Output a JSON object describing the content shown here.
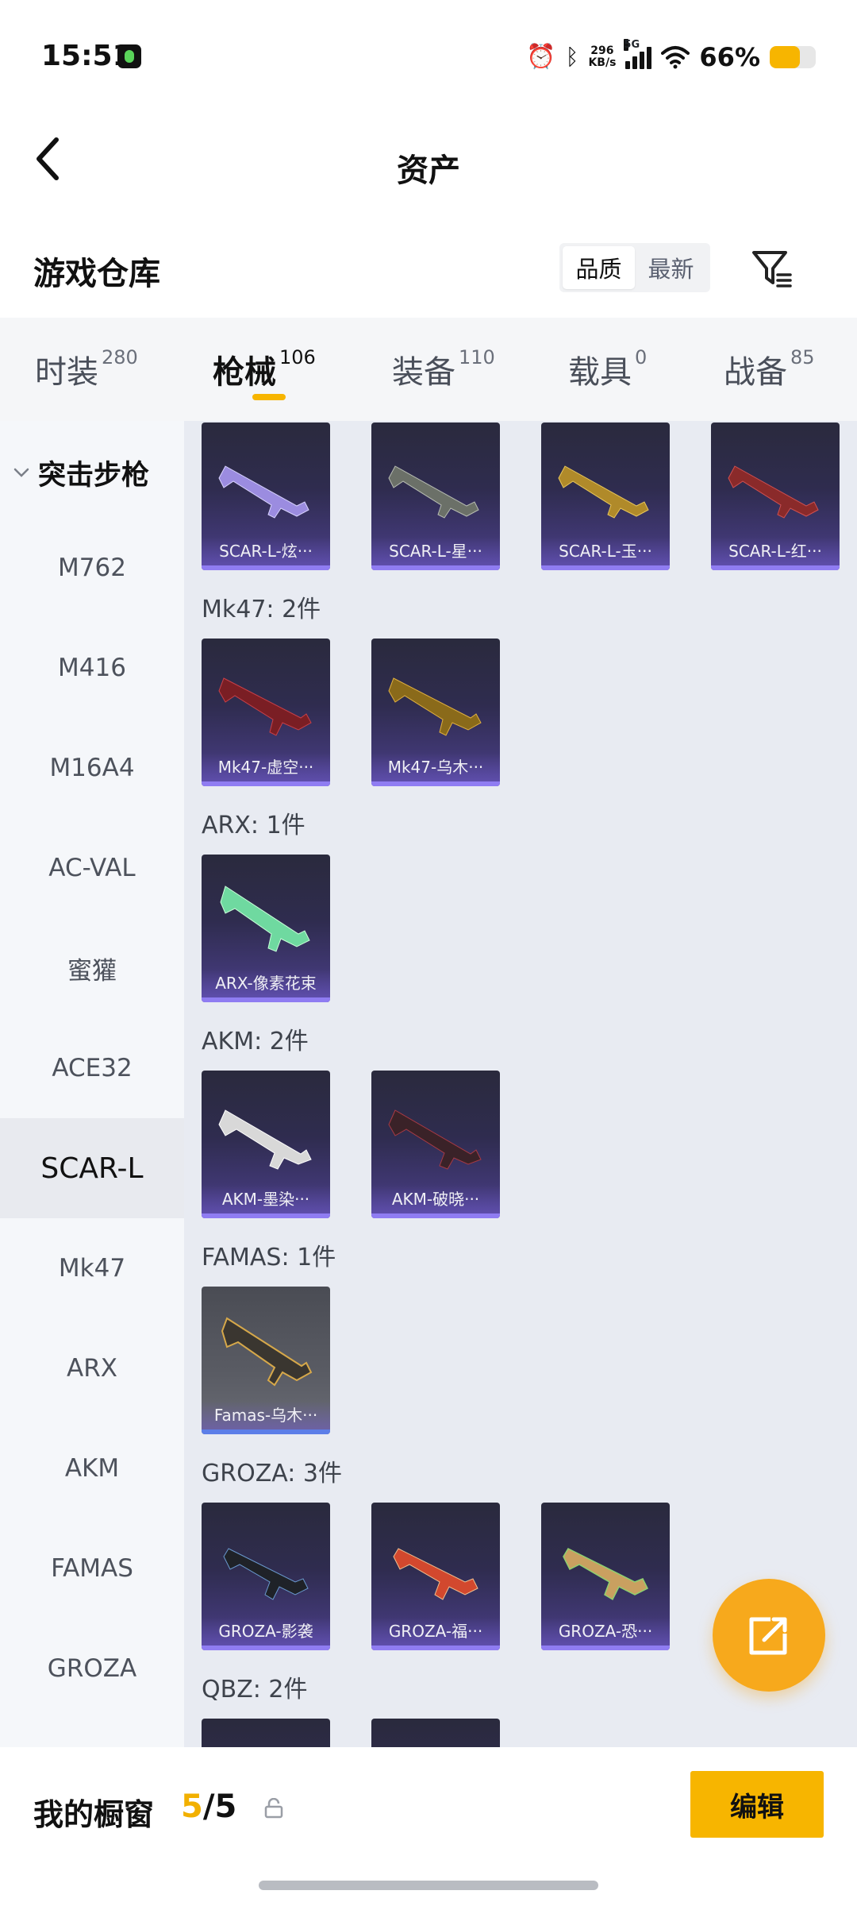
{
  "status": {
    "time": "15:51",
    "speed_top": "296",
    "speed_bottom": "KB/s",
    "network": "5G",
    "battery_pct": "66%",
    "battery_level": 0.66
  },
  "header": {
    "title": "资产"
  },
  "section": {
    "title": "游戏仓库",
    "sort_options": [
      "品质",
      "最新"
    ],
    "sort_active": "品质"
  },
  "tabs": [
    {
      "label": "时装",
      "count": "280"
    },
    {
      "label": "枪械",
      "count": "106",
      "active": true
    },
    {
      "label": "装备",
      "count": "110"
    },
    {
      "label": "载具",
      "count": "0"
    },
    {
      "label": "战备",
      "count": "85"
    }
  ],
  "sidebar": {
    "group": "突击步枪",
    "items": [
      "M762",
      "M416",
      "M16A4",
      "AC-VAL",
      "蜜獾",
      "ACE32",
      "SCAR-L",
      "Mk47",
      "ARX",
      "AKM",
      "FAMAS",
      "GROZA"
    ],
    "active": "SCAR-L"
  },
  "content": {
    "top_row": [
      "SCAR-L-炫···",
      "SCAR-L-星···",
      "SCAR-L-玉···",
      "SCAR-L-红···"
    ],
    "groups": [
      {
        "heading": "Mk47: 2件",
        "items": [
          "Mk47-虚空···",
          "Mk47-乌木···"
        ]
      },
      {
        "heading": "ARX: 1件",
        "items": [
          "ARX-像素花束"
        ]
      },
      {
        "heading": "AKM: 2件",
        "items": [
          "AKM-墨染···",
          "AKM-破晓···"
        ]
      },
      {
        "heading": "FAMAS: 1件",
        "items": [
          "Famas-乌木···"
        ]
      },
      {
        "heading": "GROZA: 3件",
        "items": [
          "GROZA-影袭",
          "GROZA-福···",
          "GROZA-恐···"
        ]
      },
      {
        "heading": "QBZ: 2件",
        "items": [
          "",
          ""
        ]
      }
    ]
  },
  "bottom": {
    "showcase_label": "我的橱窗",
    "showcase_current": "5",
    "showcase_sep": "/",
    "showcase_max": "5",
    "edit_label": "编辑"
  },
  "colors": {
    "accent": "#f7b500",
    "fab": "#f7a91c",
    "content_bg": "#e8ebf2"
  },
  "icons": [
    "back-arrow-icon",
    "filter-icon",
    "share-icon",
    "lock-icon",
    "chevron-down-icon"
  ]
}
